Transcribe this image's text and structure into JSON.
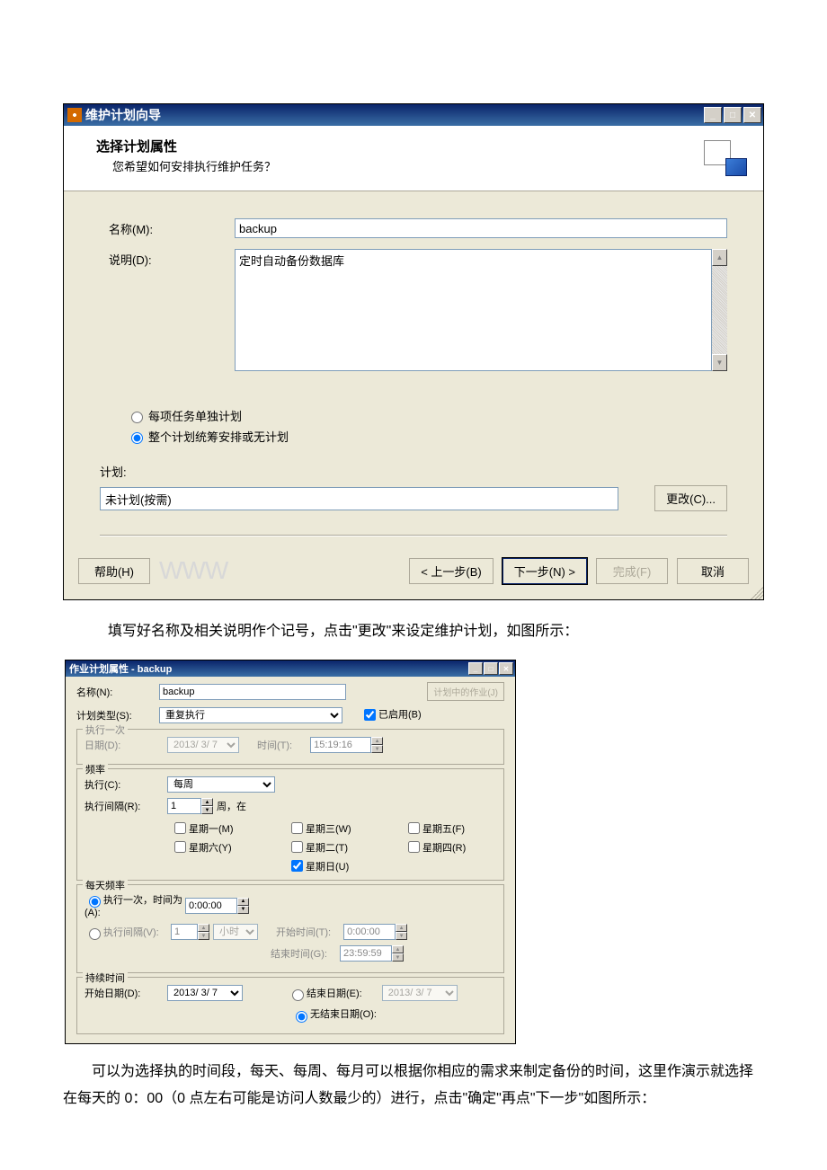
{
  "dialog1": {
    "title": "维护计划向导",
    "header": "选择计划属性",
    "subheader": "您希望如何安排执行维护任务？",
    "name_label": "名称(M):",
    "name_value": "backup",
    "desc_label": "说明(D):",
    "desc_value": "定时自动备份数据库",
    "radio1": "每项任务单独计划",
    "radio2": "整个计划统筹安排或无计划",
    "plan_label": "计划:",
    "plan_value": "未计划(按需)",
    "change_btn": "更改(C)...",
    "help_btn": "帮助(H)",
    "back_btn": "< 上一步(B)",
    "next_btn": "下一步(N) >",
    "finish_btn": "完成(F)",
    "cancel_btn": "取消"
  },
  "doc": {
    "p1": "填写好名称及相关说明作个记号，点击\"更改\"来设定维护计划，如图所示：",
    "p2": "可以为选择执的时间段，每天、每周、每月可以根据你相应的需求来制定备份的时间，这里作演示就选择在每天的 0：00（0 点左右可能是访问人数最少的）进行，点击\"确定\"再点\"下一步\"如图所示："
  },
  "dialog2": {
    "title": "作业计划属性 - backup",
    "name_label": "名称(N):",
    "name_value": "backup",
    "jobs_btn": "计划中的作业(J)",
    "type_label": "计划类型(S):",
    "type_value": "重复执行",
    "enabled": "已启用(B)",
    "once_title": "执行一次",
    "once_date_label": "日期(D):",
    "once_date_value": "2013/ 3/ 7",
    "once_time_label": "时间(T):",
    "once_time_value": "15:19:16",
    "freq_title": "频率",
    "occur_label": "执行(C):",
    "occur_value": "每周",
    "interval_label": "执行间隔(R):",
    "interval_value": "1",
    "interval_unit": "周，在",
    "days": {
      "mon": "星期一(M)",
      "tue": "星期二(T)",
      "wed": "星期三(W)",
      "thu": "星期四(R)",
      "fri": "星期五(F)",
      "sat": "星期六(Y)",
      "sun": "星期日(U)"
    },
    "daily_title": "每天频率",
    "daily_once": "执行一次，时间为(A):",
    "daily_once_val": "0:00:00",
    "daily_every": "执行间隔(V):",
    "daily_every_val": "1",
    "daily_every_unit": "小时",
    "start_time_label": "开始时间(T):",
    "start_time_val": "0:00:00",
    "end_time_label": "结束时间(G):",
    "end_time_val": "23:59:59",
    "dur_title": "持续时间",
    "start_date_label": "开始日期(D):",
    "start_date_val": "2013/ 3/ 7",
    "end_date_label": "结束日期(E):",
    "end_date_val": "2013/ 3/ 7",
    "no_end": "无结束日期(O):"
  }
}
